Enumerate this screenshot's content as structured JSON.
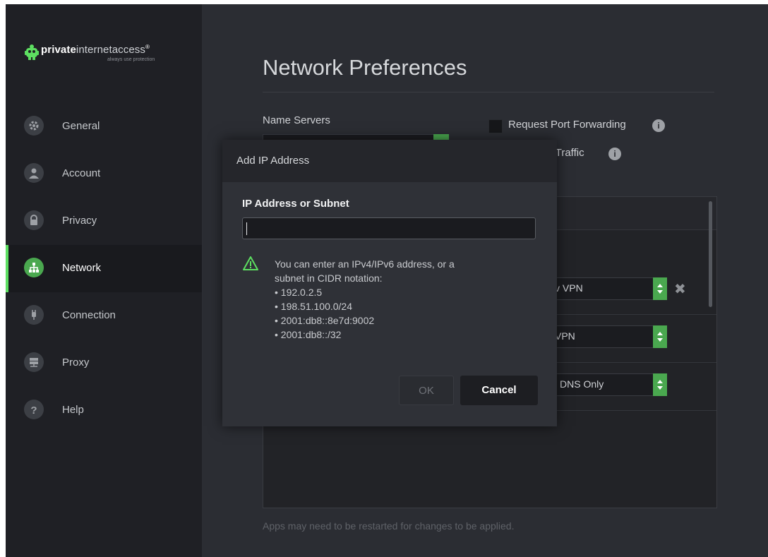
{
  "brand": {
    "name_bold": "private",
    "name_rest": "internetaccess",
    "registered": "®",
    "tagline": "always use protection"
  },
  "sidebar": {
    "items": [
      {
        "label": "General",
        "icon": "gear-icon"
      },
      {
        "label": "Account",
        "icon": "user-icon"
      },
      {
        "label": "Privacy",
        "icon": "lock-icon"
      },
      {
        "label": "Network",
        "icon": "network-icon",
        "active": true
      },
      {
        "label": "Connection",
        "icon": "plug-icon"
      },
      {
        "label": "Proxy",
        "icon": "server-icon"
      },
      {
        "label": "Help",
        "icon": "question-icon"
      }
    ]
  },
  "main": {
    "title": "Network Preferences",
    "name_servers_label": "Name Servers",
    "port_forwarding_label": "Request Port Forwarding",
    "lan_traffic_label": "N Traffic",
    "app_rows": [
      {
        "value": "v VPN"
      },
      {
        "value": "VPN"
      },
      {
        "value": "l DNS Only"
      }
    ],
    "hint": "Apps may need to be restarted for changes to be applied."
  },
  "dialog": {
    "title": "Add IP Address",
    "field_label": "IP Address or Subnet",
    "field_value": "",
    "message_line1": "You can enter an IPv4/IPv6 address, or a",
    "message_line2": "subnet in CIDR notation:",
    "examples": [
      "• 192.0.2.5",
      "• 198.51.100.0/24",
      "• 2001:db8::8e7d:9002",
      "• 2001:db8::/32"
    ],
    "ok_label": "OK",
    "cancel_label": "Cancel"
  },
  "colors": {
    "accent_green": "#4aa84f",
    "sidebar_bg": "#1f2025",
    "content_bg": "#2b2d33",
    "dialog_bg": "#2f3137"
  }
}
